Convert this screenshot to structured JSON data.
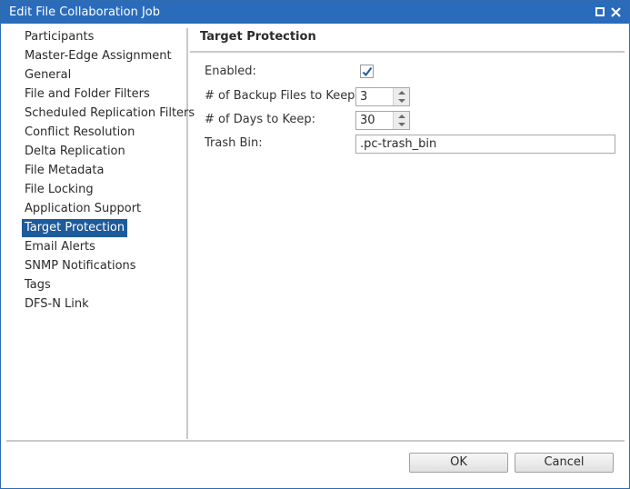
{
  "window": {
    "title": "Edit File Collaboration Job",
    "maximize_icon": "maximize-icon",
    "close_icon": "close-icon"
  },
  "sidebar": {
    "items": [
      {
        "label": "Participants"
      },
      {
        "label": "Master-Edge Assignment"
      },
      {
        "label": "General"
      },
      {
        "label": "File and Folder Filters"
      },
      {
        "label": "Scheduled Replication Filters"
      },
      {
        "label": "Conflict Resolution"
      },
      {
        "label": "Delta Replication"
      },
      {
        "label": "File Metadata"
      },
      {
        "label": "File Locking"
      },
      {
        "label": "Application Support"
      },
      {
        "label": "Target Protection"
      },
      {
        "label": "Email Alerts"
      },
      {
        "label": "SNMP Notifications"
      },
      {
        "label": "Tags"
      },
      {
        "label": "DFS-N Link"
      }
    ],
    "selected_index": 10,
    "selected_color": "#1e5b9a"
  },
  "panel": {
    "title": "Target Protection",
    "enabled_label": "Enabled:",
    "enabled_checked": true,
    "backup_files_label": "# of Backup Files to Keep:",
    "backup_files_value": "3",
    "days_label": "# of Days to Keep:",
    "days_value": "30",
    "trash_label": "Trash Bin:",
    "trash_value": ".pc-trash_bin"
  },
  "footer": {
    "ok_label": "OK",
    "cancel_label": "Cancel"
  },
  "colors": {
    "titlebar": "#2a6cbb",
    "selection": "#1e5b9a",
    "checkmark": "#1e5b9a"
  }
}
